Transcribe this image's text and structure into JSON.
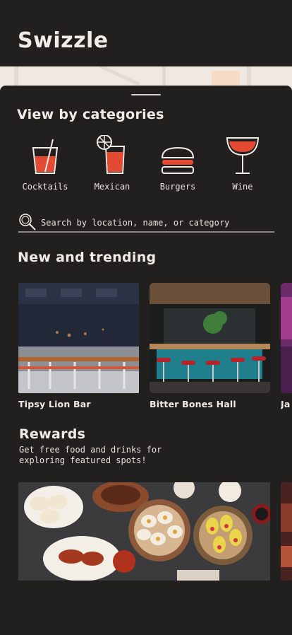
{
  "app": {
    "title": "Swizzle"
  },
  "categories": {
    "title": "View by categories",
    "items": [
      {
        "label": "Cocktails",
        "icon": "cocktail-glass-icon"
      },
      {
        "label": "Mexican",
        "icon": "margarita-lime-icon"
      },
      {
        "label": "Burgers",
        "icon": "burger-icon"
      },
      {
        "label": "Wine",
        "icon": "wine-glass-icon"
      }
    ]
  },
  "search": {
    "placeholder": "Search by location, name, or category",
    "value": "",
    "icon": "search-icon"
  },
  "trending": {
    "title": "New and trending",
    "items": [
      {
        "name": "Tipsy Lion Bar"
      },
      {
        "name": "Bitter Bones Hall"
      },
      {
        "name": "Ja"
      }
    ]
  },
  "rewards": {
    "title": "Rewards",
    "subtitle": "Get free food and drinks for exploring featured spots!"
  },
  "colors": {
    "background": "#221f1f",
    "text": "#f1ece5",
    "accent_red": "#e24b31",
    "map": "#efe9e2"
  }
}
